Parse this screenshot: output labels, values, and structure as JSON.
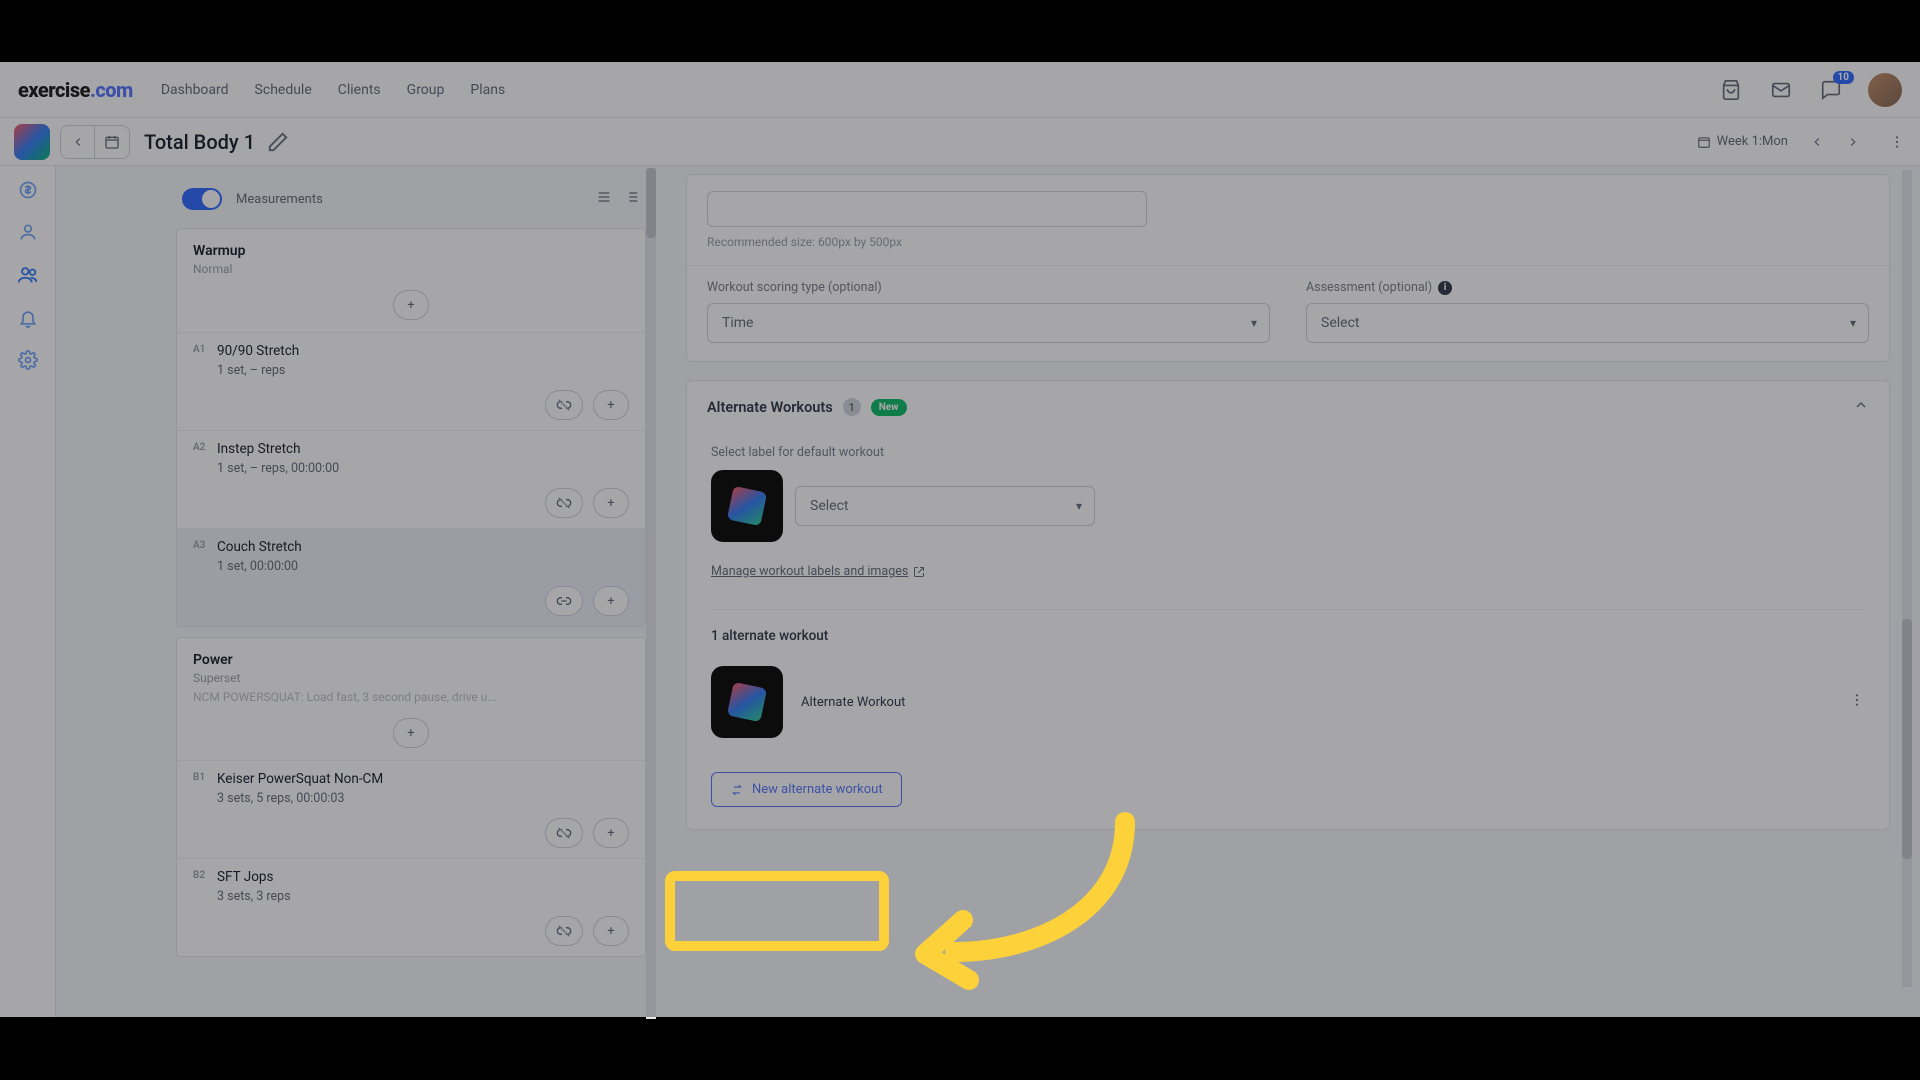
{
  "nav": {
    "brand_a": "exercise",
    "brand_b": ".com",
    "links": [
      "Dashboard",
      "Schedule",
      "Clients",
      "Group",
      "Plans"
    ],
    "notification_count": "10"
  },
  "subheader": {
    "page_title": "Total Body 1",
    "week_label": "Week 1:Mon"
  },
  "left": {
    "measurements_label": "Measurements",
    "blocks": [
      {
        "title": "Warmup",
        "subtitle": "Normal",
        "desc": "",
        "exercises": [
          {
            "code": "A1",
            "name": "90/90 Stretch",
            "detail": "1 set, – reps",
            "active": false
          },
          {
            "code": "A2",
            "name": "Instep Stretch",
            "detail": "1 set, – reps, 00:00:00",
            "active": false
          },
          {
            "code": "A3",
            "name": "Couch Stretch",
            "detail": "1 set, 00:00:00",
            "active": true
          }
        ]
      },
      {
        "title": "Power",
        "subtitle": "Superset",
        "desc": "NCM POWERSQUAT: Load fast, 3 second pause, drive u...",
        "exercises": [
          {
            "code": "B1",
            "name": "Keiser PowerSquat Non-CM",
            "detail": "3 sets, 5 reps, 00:00:03",
            "active": false
          },
          {
            "code": "B2",
            "name": "SFT Jops",
            "detail": "3 sets, 3 reps",
            "active": false
          }
        ]
      }
    ]
  },
  "right": {
    "size_hint": "Recommended size: 600px by 500px",
    "scoring_label": "Workout scoring type (optional)",
    "scoring_value": "Time",
    "assessment_label": "Assessment (optional)",
    "assessment_value": "Select",
    "alt_title": "Alternate Workouts",
    "alt_count": "1",
    "new_tag": "New",
    "default_label": "Select label for default workout",
    "default_select": "Select",
    "manage_link": "Manage workout labels and images",
    "alt_list_heading": "1 alternate workout",
    "alt_item_name": "Alternate Workout",
    "new_alt_button": "New alternate workout"
  }
}
